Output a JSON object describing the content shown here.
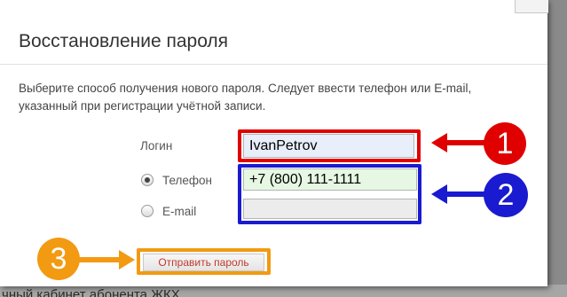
{
  "backdrop_text": "чный кабинет абонента ЖКХ",
  "dialog": {
    "title": "Восстановление пароля",
    "instructions": "Выберите способ получения нового пароля. Следует ввести телефон или E-mail, указанный при регистрации учётной записи.",
    "login": {
      "label": "Логин",
      "value": "IvanPetrov"
    },
    "phone": {
      "label": "Телефон",
      "value": "+7 (800) 111-1111",
      "selected": true
    },
    "email": {
      "label": "E-mail",
      "value": "",
      "selected": false
    },
    "submit_label": "Отправить пароль"
  },
  "annotations": [
    {
      "number": "1",
      "color": "#e00000"
    },
    {
      "number": "2",
      "color": "#1a1ad0"
    },
    {
      "number": "3",
      "color": "#f29a12"
    }
  ]
}
